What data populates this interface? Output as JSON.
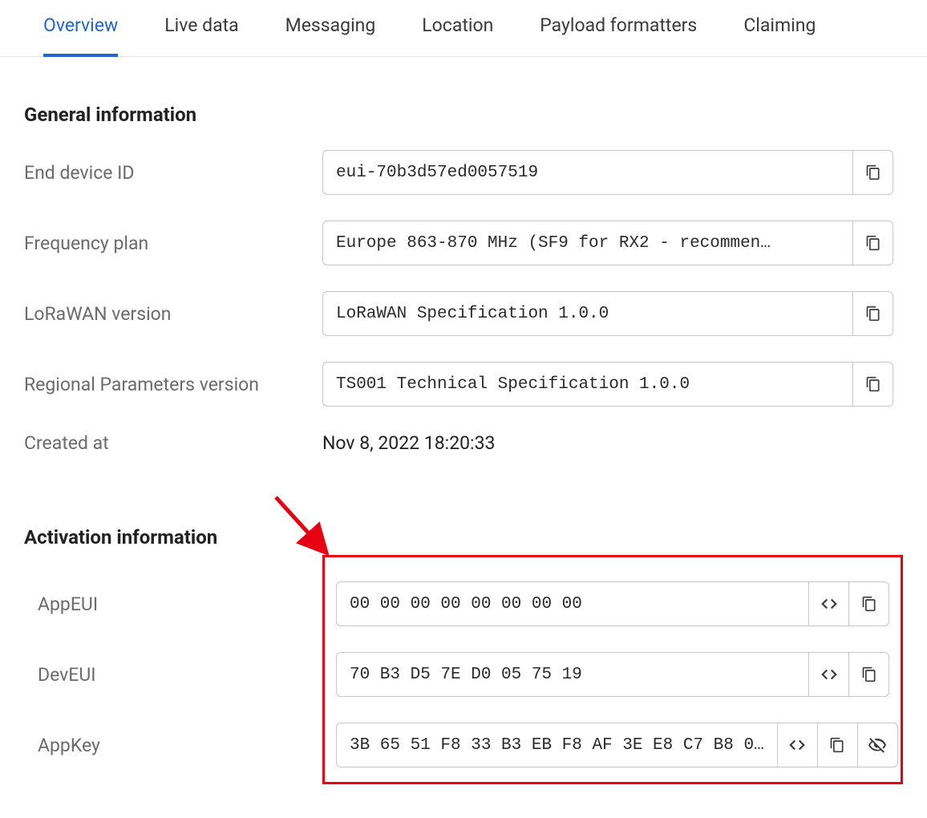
{
  "tabs": {
    "overview": "Overview",
    "live_data": "Live data",
    "messaging": "Messaging",
    "location": "Location",
    "payload_formatters": "Payload formatters",
    "claiming": "Claiming"
  },
  "sections": {
    "general": "General information",
    "activation": "Activation information"
  },
  "general": {
    "end_device_id": {
      "label": "End device ID",
      "value": "eui-70b3d57ed0057519"
    },
    "frequency_plan": {
      "label": "Frequency plan",
      "value": "Europe 863-870 MHz (SF9 for RX2 - recommen…"
    },
    "lorawan_version": {
      "label": "LoRaWAN version",
      "value": "LoRaWAN Specification 1.0.0"
    },
    "regional_params": {
      "label": "Regional Parameters version",
      "value": "TS001 Technical Specification 1.0.0"
    },
    "created_at": {
      "label": "Created at",
      "value": "Nov 8, 2022 18:20:33"
    }
  },
  "activation": {
    "appeui": {
      "label": "AppEUI",
      "value": "00 00 00 00 00 00 00 00"
    },
    "deveui": {
      "label": "DevEUI",
      "value": "70 B3 D5 7E D0 05 75 19"
    },
    "appkey": {
      "label": "AppKey",
      "value": "3B 65 51 F8 33 B3 EB F8 AF 3E E8 C7 B8 0…"
    }
  }
}
